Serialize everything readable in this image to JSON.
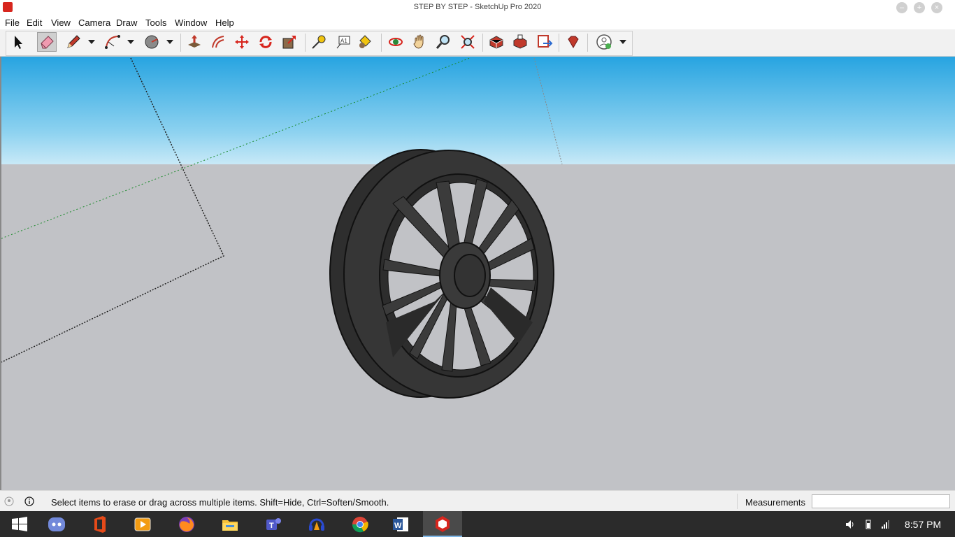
{
  "window": {
    "title": "STEP BY STEP - SketchUp Pro 2020"
  },
  "menu": [
    "File",
    "Edit",
    "View",
    "Camera",
    "Draw",
    "Tools",
    "Window",
    "Help"
  ],
  "toolbar": {
    "tools": [
      "select-icon",
      "eraser-icon",
      "pencil-icon",
      "arc-icon",
      "circle-tool-icon",
      "push-pull-icon",
      "offset-icon",
      "move-icon",
      "rotate-icon",
      "scale-icon",
      "tape-measure-icon",
      "text-icon",
      "paint-bucket-icon",
      "orbit-icon",
      "pan-icon",
      "zoom-icon",
      "zoom-extents-icon",
      "3d-warehouse-icon",
      "extension-warehouse-icon",
      "layout-send-icon",
      "ruby-console-icon",
      "account-icon"
    ],
    "active_tool": "eraser-icon"
  },
  "status": {
    "hint": "Select items to erase or drag across multiple items. Shift=Hide, Ctrl=Soften/Smooth.",
    "measurements_label": "Measurements",
    "measurements_value": ""
  },
  "taskbar": {
    "apps": [
      "windows-start-icon",
      "discord-icon",
      "office-icon",
      "video-player-icon",
      "firefox-icon",
      "file-explorer-icon",
      "teams-icon",
      "audio-app-icon",
      "chrome-icon",
      "word-icon",
      "sketchup-icon"
    ],
    "active_app": "sketchup-icon",
    "time": "8:57 PM"
  },
  "colors": {
    "sky_top": "#27a4e1",
    "ground": "#c1c2c6",
    "wheel": "#3a3a3a",
    "accent_red": "#d7261e"
  }
}
